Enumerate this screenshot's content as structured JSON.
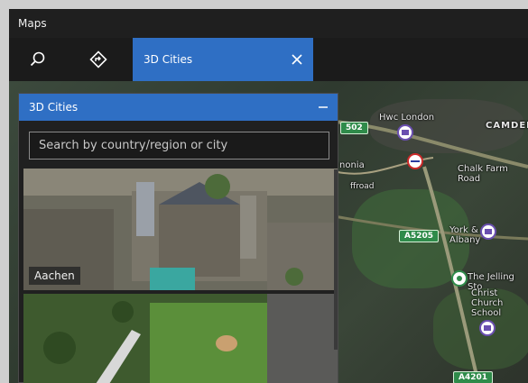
{
  "app": {
    "title": "Maps"
  },
  "toolbar": {
    "search_icon": "search-icon",
    "directions_icon": "directions-icon",
    "active_tab": {
      "label": "3D Cities",
      "close_icon": "close-icon"
    }
  },
  "panel": {
    "title": "3D Cities",
    "minimize_icon": "minimize-icon",
    "search": {
      "placeholder": "Search by country/region or city",
      "value": ""
    },
    "cities": [
      {
        "label": "Aachen"
      },
      {
        "label": ""
      }
    ]
  },
  "map": {
    "labels": [
      "Hwc London",
      "CAMDEN",
      "Chalk Farm Road",
      "nonia",
      "York & Albany",
      "The Jelling Sto",
      "Christ Church School",
      "ffroad"
    ],
    "roads": [
      "502",
      "A5205",
      "A4201"
    ]
  },
  "colors": {
    "accent": "#2f6fc4",
    "window_bg": "#1f1f1f",
    "road_green": "#2f8b4a"
  }
}
